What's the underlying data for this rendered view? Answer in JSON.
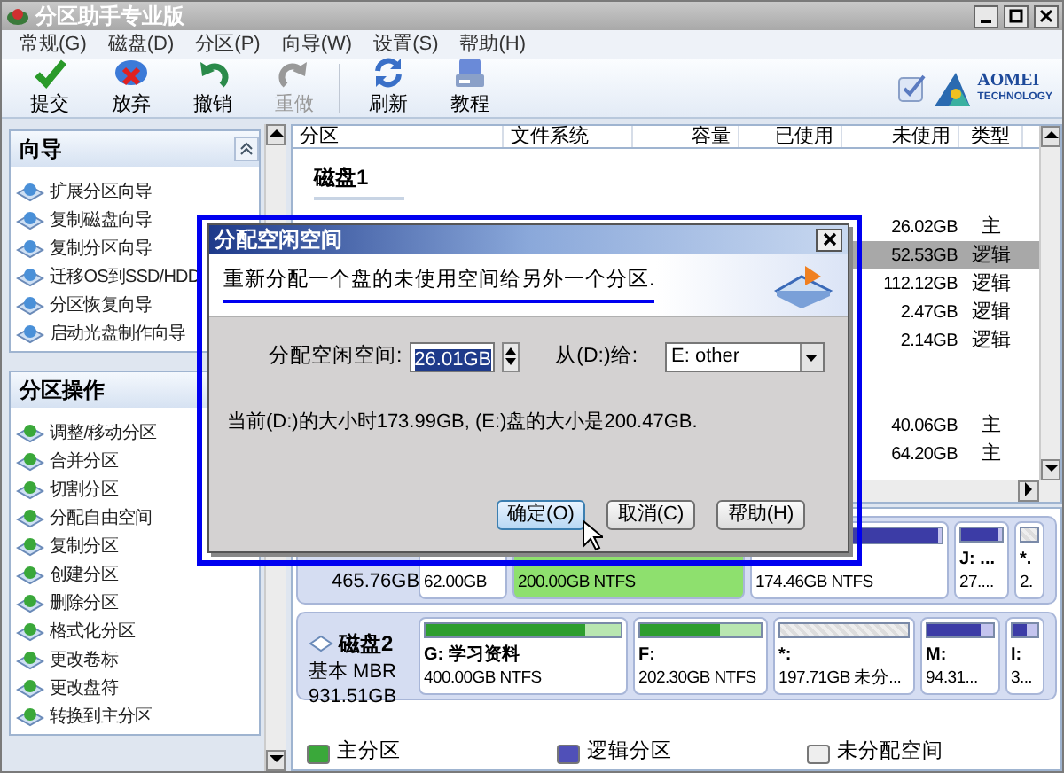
{
  "window": {
    "title": "分区助手专业版"
  },
  "menu": [
    "常规(G)",
    "磁盘(D)",
    "分区(P)",
    "向导(W)",
    "设置(S)",
    "帮助(H)"
  ],
  "toolbar": [
    {
      "label": "提交",
      "disabled": false
    },
    {
      "label": "放弃",
      "disabled": false
    },
    {
      "label": "撤销",
      "disabled": false
    },
    {
      "label": "重做",
      "disabled": true
    },
    {
      "label": "刷新",
      "disabled": false
    },
    {
      "label": "教程",
      "disabled": false
    }
  ],
  "logo": {
    "name": "AOMEI",
    "subtitle": "TECHNOLOGY"
  },
  "sidebar": {
    "sections": [
      {
        "title": "向导",
        "items": [
          "扩展分区向导",
          "复制磁盘向导",
          "复制分区向导",
          "迁移OS到SSD/HDD",
          "分区恢复向导",
          "启动光盘制作向导"
        ]
      },
      {
        "title": "分区操作",
        "items": [
          "调整/移动分区",
          "合并分区",
          "切割分区",
          "分配自由空间",
          "复制分区",
          "创建分区",
          "删除分区",
          "格式化分区",
          "更改卷标",
          "更改盘符",
          "转换到主分区"
        ]
      }
    ]
  },
  "table": {
    "columns": [
      "分区",
      "文件系统",
      "容量",
      "已使用",
      "未使用",
      "类型"
    ],
    "rows": [
      {
        "kind": "disk",
        "label": "磁盘1"
      },
      {
        "kind": "partition",
        "unused": "26.02GB",
        "type": "主",
        "selected": false
      },
      {
        "kind": "partition",
        "unused": "52.53GB",
        "type": "逻辑",
        "selected": true
      },
      {
        "kind": "partition",
        "unused": "112.12GB",
        "type": "逻辑",
        "selected": false
      },
      {
        "kind": "partition",
        "unused": "2.47GB",
        "type": "逻辑",
        "selected": false
      },
      {
        "kind": "partition",
        "unused": "2.14GB",
        "type": "逻辑",
        "selected": false
      },
      {
        "kind": "blank"
      },
      {
        "kind": "blank"
      },
      {
        "kind": "partition",
        "unused": "40.06GB",
        "type": "主",
        "selected": false
      },
      {
        "kind": "partition",
        "unused": "64.20GB",
        "type": "主",
        "selected": false
      }
    ]
  },
  "disk_map": [
    {
      "size": "465.76GB",
      "partitions": [
        {
          "kind": "primary",
          "size": "62.00GB",
          "selected": false
        },
        {
          "kind": "primary",
          "size": "200.00GB NTFS",
          "selected": true
        },
        {
          "kind": "logical",
          "size": "174.46GB NTFS",
          "level": 0.98,
          "selected": false
        },
        {
          "kind": "logical",
          "name": "J: ...",
          "size": "27....",
          "level": 0.9,
          "selected": false
        },
        {
          "kind": "unallocated",
          "name": "*.",
          "size": "2.",
          "selected": false
        }
      ]
    },
    {
      "name": "磁盘2",
      "type": "基本 MBR",
      "size": "931.51GB",
      "partitions": [
        {
          "kind": "primary",
          "name": "G: 学习资料",
          "size": "400.00GB NTFS",
          "level": 0.82,
          "selected": false
        },
        {
          "kind": "primary",
          "name": "F:",
          "size": "202.30GB NTFS",
          "level": 0.66,
          "selected": false
        },
        {
          "kind": "unallocated",
          "name": "*:",
          "size": "197.71GB 未分...",
          "selected": false
        },
        {
          "kind": "logical",
          "name": "M:",
          "size": "94.31...",
          "level": 0.8,
          "selected": false
        },
        {
          "kind": "logical",
          "name": "I:",
          "size": "3...",
          "level": 0.55,
          "selected": false
        }
      ]
    }
  ],
  "legend": [
    {
      "kind": "primary",
      "label": "主分区"
    },
    {
      "kind": "logical",
      "label": "逻辑分区"
    },
    {
      "kind": "unallocated",
      "label": "未分配空间"
    }
  ],
  "dialog": {
    "title": "分配空闲空间",
    "description": "重新分配一个盘的未使用空间给另外一个分区.",
    "amount_label": "分配空闲空间:",
    "amount_value": "26.01GB",
    "target_label": "从(D:)给:",
    "target_value": "E: other",
    "info": "当前(D:)的大小时173.99GB, (E:)盘的大小是200.47GB.",
    "buttons": [
      {
        "label": "确定(O)",
        "selected": true
      },
      {
        "label": "取消(C)",
        "selected": false
      },
      {
        "label": "帮助(H)",
        "selected": false
      }
    ]
  }
}
